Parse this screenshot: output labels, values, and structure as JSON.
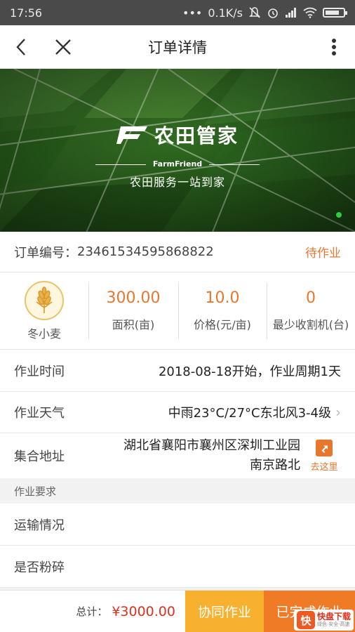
{
  "status_bar": {
    "time": "17:56",
    "network_speed": "0.1K/s",
    "battery_level": 0.8
  },
  "nav": {
    "title": "订单详情",
    "back_icon": "chevron-left-icon",
    "close_icon": "close-icon",
    "more_icon": "more-vertical-icon"
  },
  "banner": {
    "brand_name": "农田管家",
    "brand_english": "FarmFriend",
    "slogan": "农田服务一站到家",
    "active_dot_color": "#2ecc40"
  },
  "order": {
    "number_label": "订单编号：",
    "number": "23461534595868822",
    "status": "待作业"
  },
  "stats": {
    "crop_name": "冬小麦",
    "crop_icon": "wheat-icon",
    "items": [
      {
        "value": "300.00",
        "label": "面积(亩)"
      },
      {
        "value": "10.0",
        "label": "价格(元/亩)"
      },
      {
        "value": "0",
        "label": "最少收割机(台)"
      }
    ]
  },
  "details": {
    "work_time_label": "作业时间",
    "work_time_value": "2018-08-18开始，作业周期1天",
    "weather_label": "作业天气",
    "weather_value": "中雨23°C/27°C东北风3-4级",
    "address_label": "集合地址",
    "address_line1": "湖北省襄阳市襄州区深圳工业园",
    "address_line2": "南京路北",
    "goto_label": "去这里"
  },
  "requirements": {
    "section_title": "作业要求",
    "transport_label": "运输情况",
    "crush_label": "是否粉碎"
  },
  "footer": {
    "total_label": "总计：",
    "total_value": "¥3000.00",
    "coop_button": "协同作业",
    "done_button": "已完成作业",
    "watermark_title": "快盘下载",
    "watermark_sub": "绿色·安全·高速"
  },
  "colors": {
    "accent_orange": "#e8772e",
    "button_yellow": "#f7b12f",
    "button_orange": "#ef7b26",
    "price_red": "#e0301e"
  }
}
